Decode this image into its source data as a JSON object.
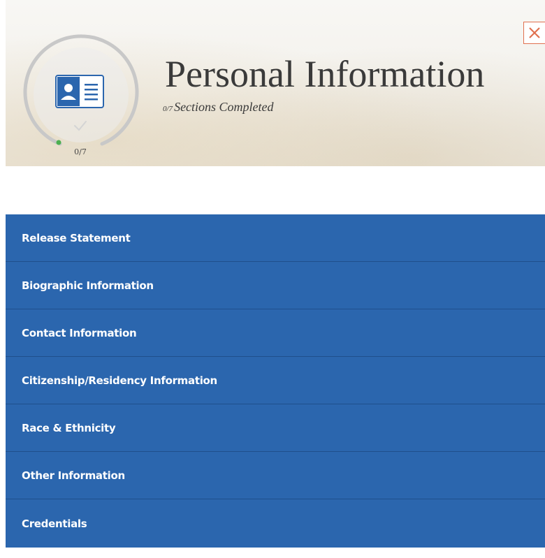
{
  "header": {
    "title": "Personal Information",
    "progress_count": "0/7",
    "progress_suffix": "Sections Completed",
    "ring_counter": "0/7",
    "progress_fraction": 0,
    "close_label": "✕"
  },
  "colors": {
    "accent_blue": "#2b66ae",
    "close_red": "#e0704f",
    "ring_gray": "#c8c8c8",
    "ring_dot_green": "#4caf50"
  },
  "icons": {
    "header_icon": "id-card-icon",
    "ring_check": "checkmark-icon",
    "close": "close-icon"
  },
  "sections": [
    {
      "label": "Release Statement"
    },
    {
      "label": "Biographic Information"
    },
    {
      "label": "Contact Information"
    },
    {
      "label": "Citizenship/Residency Information"
    },
    {
      "label": "Race & Ethnicity"
    },
    {
      "label": "Other Information"
    },
    {
      "label": "Credentials"
    }
  ]
}
